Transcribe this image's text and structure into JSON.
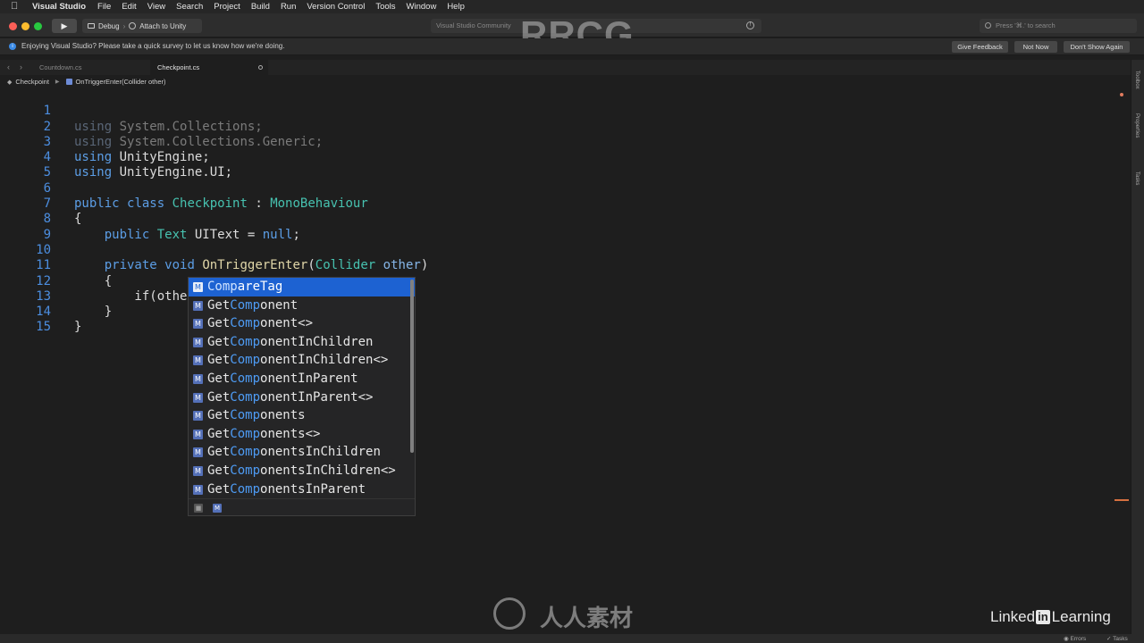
{
  "menubar": {
    "app_name": "Visual Studio",
    "items": [
      "File",
      "Edit",
      "View",
      "Search",
      "Project",
      "Build",
      "Run",
      "Version Control",
      "Tools",
      "Window",
      "Help"
    ]
  },
  "toolbar": {
    "config": "Debug",
    "target": "Attach to Unity",
    "status_text": "Visual Studio Community",
    "search_placeholder": "Press '⌘.' to search"
  },
  "infobar": {
    "message": "Enjoying Visual Studio? Please take a quick survey to let us know how we're doing.",
    "give_feedback": "Give Feedback",
    "not_now": "Not Now",
    "dont_show": "Don't Show Again"
  },
  "tabs": [
    "Countdown.cs",
    "Checkpoint.cs"
  ],
  "breadcrumb": {
    "class": "Checkpoint",
    "method": "OnTriggerEnter(Collider other)"
  },
  "dock": [
    "Toolbox",
    "Properties",
    "Tasks"
  ],
  "code": {
    "line_numbers": [
      "1",
      "2",
      "3",
      "4",
      "5",
      "6",
      "7",
      "8",
      "9",
      "10",
      "11",
      "12",
      "13",
      "14",
      "15"
    ],
    "l1": [
      "using",
      " System.Collections;"
    ],
    "l2": [
      "using",
      " System.Collections.Generic;"
    ],
    "l3": [
      "using",
      " UnityEngine;"
    ],
    "l4": [
      "using",
      " UnityEngine.UI;"
    ],
    "l6": [
      "public",
      " ",
      "class",
      " ",
      "Checkpoint",
      " : ",
      "MonoBehaviour"
    ],
    "l7": "{",
    "l8": [
      "    ",
      "public",
      " ",
      "Text",
      " UIText = ",
      "null",
      ";"
    ],
    "l10": [
      "    ",
      "private",
      " ",
      "void",
      " ",
      "OnTriggerEnter",
      "(",
      "Collider",
      " ",
      "other",
      ")"
    ],
    "l11": "    {",
    "l12": "        if(other.Comp)",
    "l13": "    }",
    "l14": "}"
  },
  "completion": {
    "icon_letter": "M",
    "items": [
      [
        "",
        "Comp",
        "areTag"
      ],
      [
        "Get",
        "Comp",
        "onent"
      ],
      [
        "Get",
        "Comp",
        "onent<>"
      ],
      [
        "Get",
        "Comp",
        "onentInChildren"
      ],
      [
        "Get",
        "Comp",
        "onentInChildren<>"
      ],
      [
        "Get",
        "Comp",
        "onentInParent"
      ],
      [
        "Get",
        "Comp",
        "onentInParent<>"
      ],
      [
        "Get",
        "Comp",
        "onents"
      ],
      [
        "Get",
        "Comp",
        "onents<>"
      ],
      [
        "Get",
        "Comp",
        "onentsInChildren"
      ],
      [
        "Get",
        "Comp",
        "onentsInChildren<>"
      ],
      [
        "Get",
        "Comp",
        "onentsInParent"
      ]
    ],
    "selected_index": 0
  },
  "statusbar": {
    "errors": "Errors",
    "tasks": "Tasks"
  },
  "overlays": {
    "watermark": "RRCG",
    "linkedin_pre": "Linked",
    "linkedin_in": "in",
    "linkedin_post": " Learning",
    "bottom_text": "人人素材"
  },
  "colors": {
    "accent_selection": "#1d62d2",
    "keyword": "#5c9ee6",
    "type": "#47c2b0"
  }
}
